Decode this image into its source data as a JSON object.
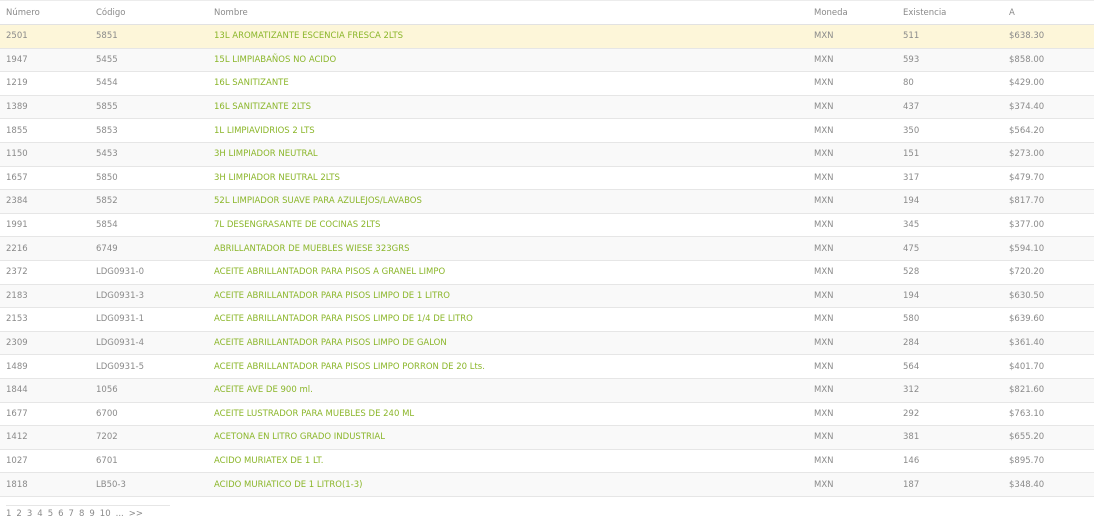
{
  "table": {
    "headers": {
      "numero": "Número",
      "codigo": "Código",
      "nombre": "Nombre",
      "moneda": "Moneda",
      "existencia": "Existencia",
      "a": "A"
    },
    "rows": [
      {
        "numero": "2501",
        "codigo": "5851",
        "nombre": "13L AROMATIZANTE ESCENCIA FRESCA 2LTS",
        "moneda": "MXN",
        "existencia": "511",
        "a": "$638.30"
      },
      {
        "numero": "1947",
        "codigo": "5455",
        "nombre": "15L LIMPIABAÑOS NO ACIDO",
        "moneda": "MXN",
        "existencia": "593",
        "a": "$858.00"
      },
      {
        "numero": "1219",
        "codigo": "5454",
        "nombre": "16L SANITIZANTE",
        "moneda": "MXN",
        "existencia": "80",
        "a": "$429.00"
      },
      {
        "numero": "1389",
        "codigo": "5855",
        "nombre": "16L SANITIZANTE 2LTS",
        "moneda": "MXN",
        "existencia": "437",
        "a": "$374.40"
      },
      {
        "numero": "1855",
        "codigo": "5853",
        "nombre": "1L LIMPIAVIDRIOS 2 LTS",
        "moneda": "MXN",
        "existencia": "350",
        "a": "$564.20"
      },
      {
        "numero": "1150",
        "codigo": "5453",
        "nombre": "3H LIMPIADOR NEUTRAL",
        "moneda": "MXN",
        "existencia": "151",
        "a": "$273.00"
      },
      {
        "numero": "1657",
        "codigo": "5850",
        "nombre": "3H LIMPIADOR NEUTRAL 2LTS",
        "moneda": "MXN",
        "existencia": "317",
        "a": "$479.70"
      },
      {
        "numero": "2384",
        "codigo": "5852",
        "nombre": "52L LIMPIADOR SUAVE PARA AZULEJOS/LAVABOS",
        "moneda": "MXN",
        "existencia": "194",
        "a": "$817.70"
      },
      {
        "numero": "1991",
        "codigo": "5854",
        "nombre": "7L DESENGRASANTE DE COCINAS 2LTS",
        "moneda": "MXN",
        "existencia": "345",
        "a": "$377.00"
      },
      {
        "numero": "2216",
        "codigo": "6749",
        "nombre": "ABRILLANTADOR DE MUEBLES WIESE 323GRS",
        "moneda": "MXN",
        "existencia": "475",
        "a": "$594.10"
      },
      {
        "numero": "2372",
        "codigo": "LDG0931-0",
        "nombre": "ACEITE ABRILLANTADOR PARA PISOS A GRANEL LIMPO",
        "moneda": "MXN",
        "existencia": "528",
        "a": "$720.20"
      },
      {
        "numero": "2183",
        "codigo": "LDG0931-3",
        "nombre": "ACEITE ABRILLANTADOR PARA PISOS LIMPO DE 1 LITRO",
        "moneda": "MXN",
        "existencia": "194",
        "a": "$630.50"
      },
      {
        "numero": "2153",
        "codigo": "LDG0931-1",
        "nombre": "ACEITE ABRILLANTADOR PARA PISOS LIMPO DE 1/4 DE LITRO",
        "moneda": "MXN",
        "existencia": "580",
        "a": "$639.60"
      },
      {
        "numero": "2309",
        "codigo": "LDG0931-4",
        "nombre": "ACEITE ABRILLANTADOR PARA PISOS LIMPO DE GALON",
        "moneda": "MXN",
        "existencia": "284",
        "a": "$361.40"
      },
      {
        "numero": "1489",
        "codigo": "LDG0931-5",
        "nombre": "ACEITE ABRILLANTADOR PARA PISOS LIMPO PORRON DE 20 Lts.",
        "moneda": "MXN",
        "existencia": "564",
        "a": "$401.70"
      },
      {
        "numero": "1844",
        "codigo": "1056",
        "nombre": "ACEITE AVE DE 900 ml.",
        "moneda": "MXN",
        "existencia": "312",
        "a": "$821.60"
      },
      {
        "numero": "1677",
        "codigo": "6700",
        "nombre": "ACEITE LUSTRADOR PARA MUEBLES DE 240 ML",
        "moneda": "MXN",
        "existencia": "292",
        "a": "$763.10"
      },
      {
        "numero": "1412",
        "codigo": "7202",
        "nombre": "ACETONA EN LITRO GRADO INDUSTRIAL",
        "moneda": "MXN",
        "existencia": "381",
        "a": "$655.20"
      },
      {
        "numero": "1027",
        "codigo": "6701",
        "nombre": "ACIDO MURIATEX DE 1 LT.",
        "moneda": "MXN",
        "existencia": "146",
        "a": "$895.70"
      },
      {
        "numero": "1818",
        "codigo": "LB50-3",
        "nombre": "ACIDO MURIATICO DE 1 LITRO(1-3)",
        "moneda": "MXN",
        "existencia": "187",
        "a": "$348.40"
      }
    ]
  },
  "pagination": {
    "pages": [
      "1",
      "2",
      "3",
      "4",
      "5",
      "6",
      "7",
      "8",
      "9",
      "10",
      "...",
      ">>"
    ]
  },
  "colors": {
    "link": "#8bb62a",
    "selected_row": "#fdf6d9",
    "alt_row": "#f9f9f9"
  }
}
